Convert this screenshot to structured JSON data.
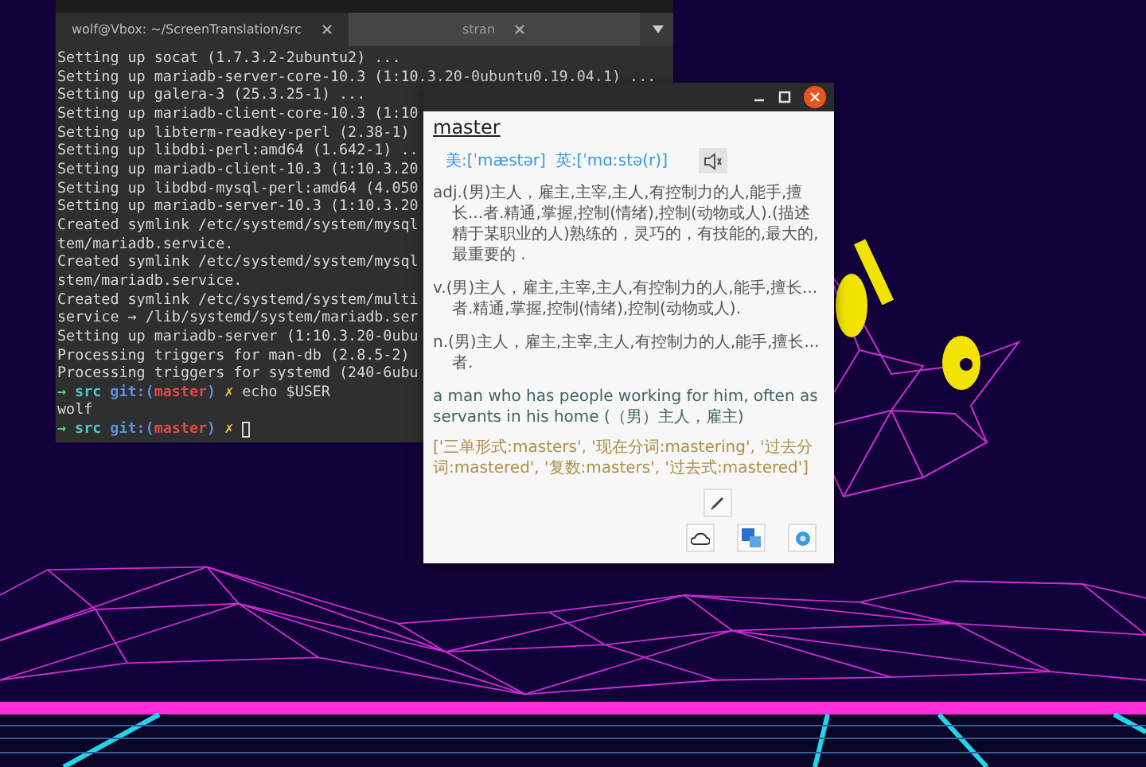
{
  "terminal": {
    "tabs": [
      {
        "label": "wolf@Vbox: ~/ScreenTranslation/src",
        "selected": true
      },
      {
        "label": "stran",
        "selected": false
      }
    ],
    "lines": [
      {
        "kind": "output",
        "text": "Setting up socat (1.7.3.2-2ubuntu2) ..."
      },
      {
        "kind": "output",
        "text": "Setting up mariadb-server-core-10.3 (1:10.3.20-0ubuntu0.19.04.1) ..."
      },
      {
        "kind": "output",
        "text": "Setting up galera-3 (25.3.25-1) ..."
      },
      {
        "kind": "output",
        "text": "Setting up mariadb-client-core-10.3 (1:10"
      },
      {
        "kind": "output",
        "text": "Setting up libterm-readkey-perl (2.38-1)"
      },
      {
        "kind": "output",
        "text": "Setting up libdbi-perl:amd64 (1.642-1) .."
      },
      {
        "kind": "output",
        "text": "Setting up mariadb-client-10.3 (1:10.3.20"
      },
      {
        "kind": "output",
        "text": "Setting up libdbd-mysql-perl:amd64 (4.050"
      },
      {
        "kind": "output",
        "text": "Setting up mariadb-server-10.3 (1:10.3.20"
      },
      {
        "kind": "output",
        "text": "Created symlink /etc/systemd/system/mysql"
      },
      {
        "kind": "output",
        "text": "tem/mariadb.service."
      },
      {
        "kind": "output",
        "text": "Created symlink /etc/systemd/system/mysql"
      },
      {
        "kind": "output",
        "text": "stem/mariadb.service."
      },
      {
        "kind": "output",
        "text": "Created symlink /etc/systemd/system/multi"
      },
      {
        "kind": "output",
        "text": "service → /lib/systemd/system/mariadb.ser"
      },
      {
        "kind": "output",
        "text": "Setting up mariadb-server (1:10.3.20-0ubu"
      },
      {
        "kind": "output",
        "text": "Processing triggers for man-db (2.8.5-2)"
      },
      {
        "kind": "output",
        "text": "Processing triggers for systemd (240-6ubu"
      },
      {
        "kind": "prompt",
        "arrow": "→",
        "dir": "src",
        "branch_open": "git:(",
        "branch": "master",
        "branch_close": ")",
        "dirty": "✗",
        "command": "echo $USER",
        "cursor": false
      },
      {
        "kind": "output",
        "text": "wolf"
      },
      {
        "kind": "prompt",
        "arrow": "→",
        "dir": "src",
        "branch_open": "git:(",
        "branch": "master",
        "branch_close": ")",
        "dirty": "✗",
        "cursor": true
      }
    ]
  },
  "dictionary": {
    "word": "master",
    "phonetics": [
      "美:[ˈmæstər]",
      "英:[ˈmɑːstə(r)]"
    ],
    "definitions": [
      "adj.(男)主人，雇主,主宰,主人,有控制力的人,能手,擅长...者.精通,掌握,控制(情绪),控制(动物或人).(描述精于某职业的人)熟练的，灵巧的，有技能的,最大的,最重要的 .",
      "v.(男)主人，雇主,主宰,主人,有控制力的人,能手,擅长...者.精通,掌握,控制(情绪),控制(动物或人).",
      "n.(男)主人，雇主,主宰,主人,有控制力的人,能手,擅长...者."
    ],
    "example": "a man who has people working for him, often as servants in his home (（男）主人，雇主)",
    "forms": "['三单形式:masters', '现在分词:mastering', '过去分词:mastered', '复数:masters', '过去式:mastered']"
  }
}
